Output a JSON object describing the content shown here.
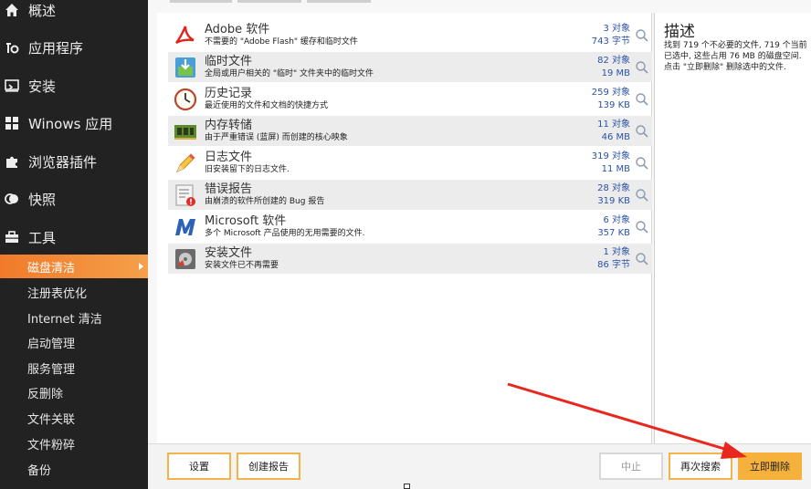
{
  "sidebar": {
    "items": [
      {
        "label": "概述",
        "icon": "home-icon"
      },
      {
        "label": "应用程序",
        "icon": "apps-icon"
      },
      {
        "label": "安装",
        "icon": "install-icon"
      },
      {
        "label": "Winows 应用",
        "icon": "windows-icon"
      },
      {
        "label": "浏览器插件",
        "icon": "puzzle-icon"
      },
      {
        "label": "快照",
        "icon": "snapshot-icon"
      },
      {
        "label": "工具",
        "icon": "toolbox-icon"
      }
    ],
    "tools": [
      {
        "label": "磁盘清洁",
        "active": true
      },
      {
        "label": "注册表优化"
      },
      {
        "label": "Internet 清洁"
      },
      {
        "label": "启动管理"
      },
      {
        "label": "服务管理"
      },
      {
        "label": "反删除"
      },
      {
        "label": "文件关联"
      },
      {
        "label": "文件粉碎"
      },
      {
        "label": "备份"
      }
    ]
  },
  "list": [
    {
      "title": "Adobe 软件",
      "desc": "不需要的 \"Adobe Flash\" 缓存和临时文件",
      "count": "3 对象",
      "size": "743 字节",
      "icon": "adobe-icon"
    },
    {
      "title": "临时文件",
      "desc": "全局或用户相关的 \"临时\" 文件夹中的临时文件",
      "count": "82 对象",
      "size": "19 MB",
      "icon": "temp-files-icon"
    },
    {
      "title": "历史记录",
      "desc": "最近使用的文件和文档的快捷方式",
      "count": "259 对象",
      "size": "139 KB",
      "icon": "clock-icon"
    },
    {
      "title": "内存转储",
      "desc": "由于严重错误 (蓝屏) 而创建的核心映象",
      "count": "11 对象",
      "size": "46 MB",
      "icon": "memory-chip-icon"
    },
    {
      "title": "日志文件",
      "desc": "旧安装留下的日志文件.",
      "count": "319 对象",
      "size": "11 MB",
      "icon": "pencil-log-icon"
    },
    {
      "title": "错误报告",
      "desc": "由崩溃的软件所创建的 Bug 报告",
      "count": "28 对象",
      "size": "319 KB",
      "icon": "error-report-icon"
    },
    {
      "title": "Microsoft 软件",
      "desc": "多个 Microsoft 产品使用的无用需要的文件.",
      "count": "6 对象",
      "size": "357 KB",
      "icon": "microsoft-icon"
    },
    {
      "title": "安装文件",
      "desc": "安装文件已不再需要",
      "count": "1 对象",
      "size": "86 字节",
      "icon": "install-files-icon"
    }
  ],
  "description": {
    "title": "描述",
    "body": "找到 719 个不必要的文件, 719 个当前已选中, 这些占用 76 MB 的磁盘空间. 点击 \"立即删除\" 删除选中的文件."
  },
  "buttons": {
    "settings": "设置",
    "create_report": "创建报告",
    "stop": "中止",
    "rescan": "再次搜索",
    "delete_now": "立即删除"
  },
  "colors": {
    "sidebar_bg": "#222222",
    "active_item": "#f07a2a",
    "accent_button": "#f5b13c",
    "annotation_arrow": "#e8271f",
    "count_text": "#2a52a8"
  }
}
